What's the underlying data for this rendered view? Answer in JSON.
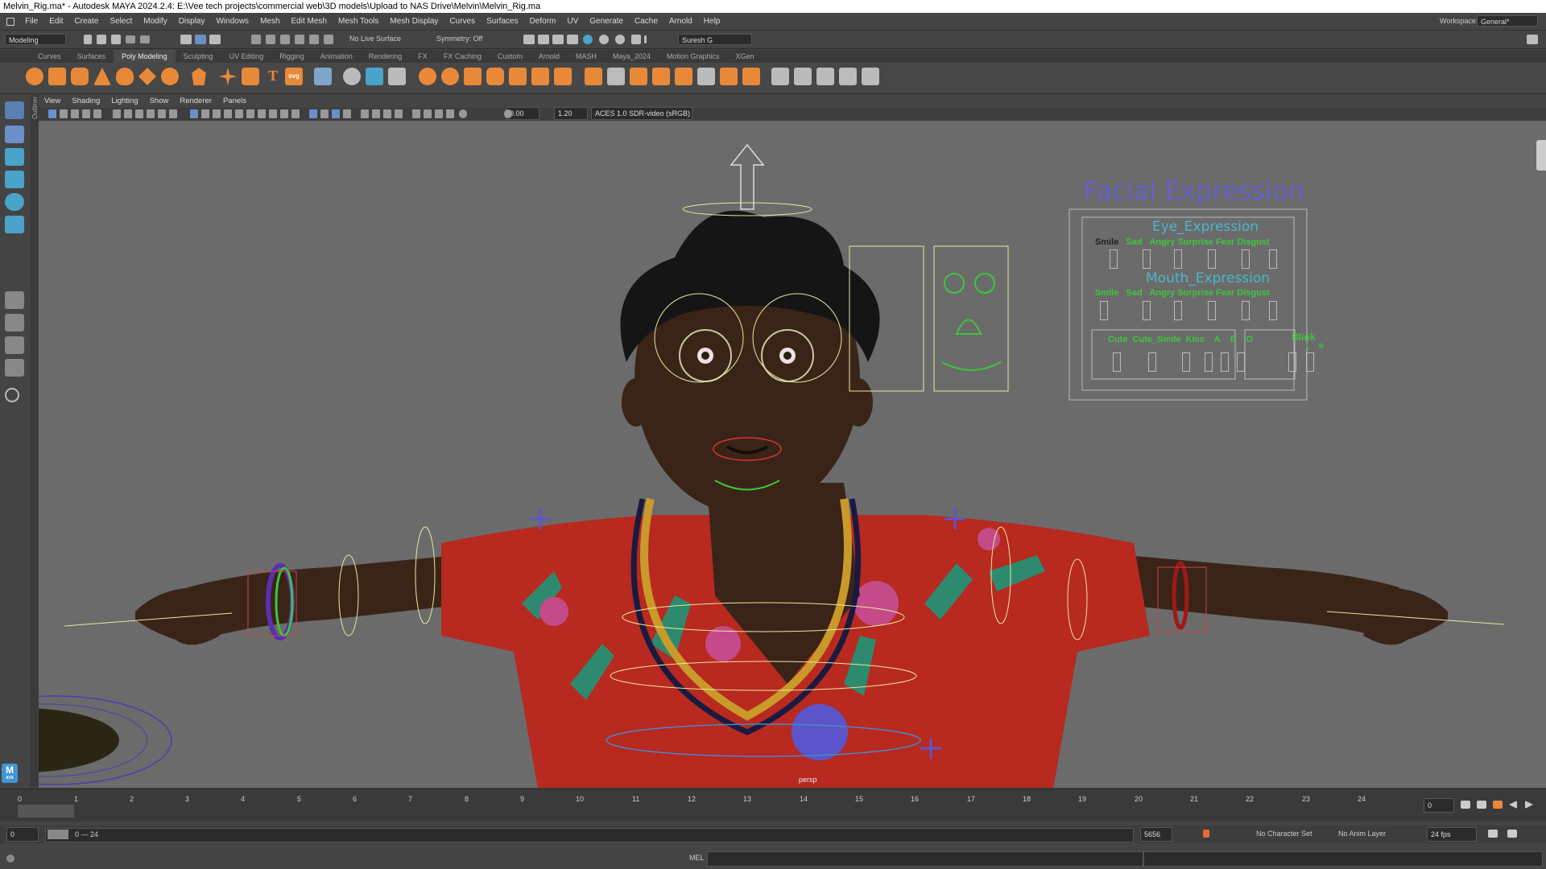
{
  "title": "Melvin_Rig.ma* - Autodesk MAYA 2024.2.4: E:\\Vee tech projects\\commercial web\\3D models\\Upload to NAS Drive\\Melvin\\Melvin_Rig.ma",
  "menu": [
    "File",
    "Edit",
    "Create",
    "Select",
    "Modify",
    "Display",
    "Windows",
    "Mesh",
    "Edit Mesh",
    "Mesh Tools",
    "Mesh Display",
    "Curves",
    "Surfaces",
    "Deform",
    "UV",
    "Generate",
    "Cache",
    "Arnold",
    "Help"
  ],
  "workspace": {
    "label": "Workspace:",
    "value": "General*"
  },
  "status": {
    "mode": "Modeling",
    "live_surface": "No Live Surface",
    "symmetry": "Symmetry: Off",
    "user": "Suresh G"
  },
  "shelf_tabs": [
    "Curves",
    "Surfaces",
    "Poly Modeling",
    "Sculpting",
    "UV Editing",
    "Rigging",
    "Animation",
    "Rendering",
    "FX",
    "FX Caching",
    "Custom",
    "Arnold",
    "MASH",
    "Maya_2024",
    "Motion Graphics",
    "XGen"
  ],
  "active_shelf_tab": "Poly Modeling",
  "outliner_label": "Outliner",
  "panel_menu": [
    "View",
    "Shading",
    "Lighting",
    "Show",
    "Renderer",
    "Panels"
  ],
  "panel_tools": {
    "exposure": "0.00",
    "gamma": "1.20",
    "colorspace": "ACES 1.0 SDR-video (sRGB)"
  },
  "camera_label": "persp",
  "facial_panel": {
    "title": "Facial Expression",
    "eye_title": "Eye_Expression",
    "eye_labels": [
      "Smile",
      "Sad",
      "Angry",
      "Surprise",
      "Fear",
      "Disgust"
    ],
    "mouth_title": "Mouth_Expression",
    "mouth_labels": [
      "Smile",
      "Sad",
      "Angry",
      "Surprise",
      "Fear",
      "Disgust"
    ],
    "phoneme_labels": [
      "Cute",
      "Cute_Smile",
      "Kiss",
      "A",
      "E",
      "O"
    ],
    "blink_title": "Blink",
    "blink_sides": [
      "L",
      "R"
    ]
  },
  "timeline": {
    "ticks": [
      "0",
      "1",
      "2",
      "3",
      "4",
      "5",
      "6",
      "7",
      "8",
      "9",
      "10",
      "11",
      "12",
      "13",
      "14",
      "15",
      "16",
      "17",
      "18",
      "19",
      "20",
      "21",
      "22",
      "23",
      "24"
    ],
    "current_frame": "0",
    "range_start": "0",
    "range_text": "0 — 24",
    "end_field": "5656",
    "char_set": "No Character Set",
    "anim_layer": "No Anim Layer",
    "fps": "24 fps"
  },
  "cmd_label": "MEL",
  "maya_logo": "M",
  "maya_logo_sub": "AYA",
  "colors": {
    "panel_text_blue": "#6a5fc8",
    "panel_text_green": "#3ec63a",
    "panel_text_cyan": "#47b7c9",
    "viewport_bg": "#6b6b6b",
    "shelf_icon": "#e8893a"
  }
}
